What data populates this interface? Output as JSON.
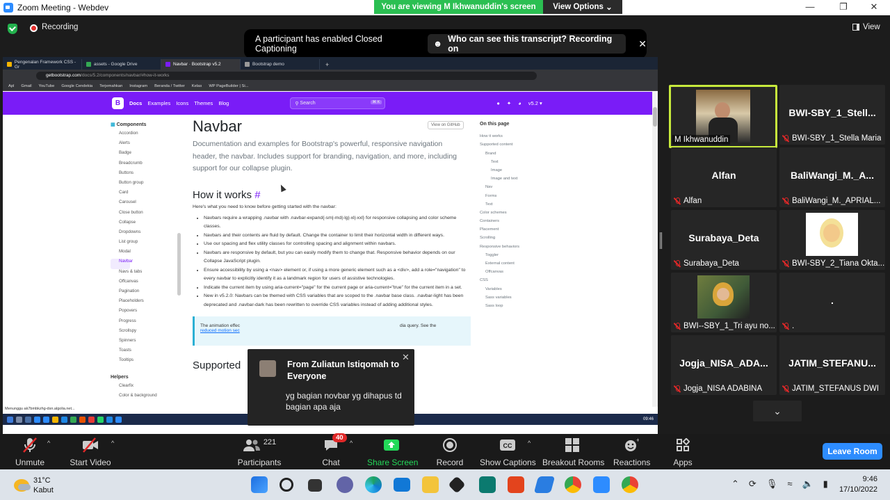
{
  "window": {
    "title": "Zoom Meeting - Webdev",
    "controls": [
      "—",
      "❐",
      "✕"
    ]
  },
  "banner": {
    "viewing": "You are viewing M Ikhwanuddin's screen",
    "view_options": "View Options"
  },
  "topbar": {
    "recording": "Recording",
    "view": "View"
  },
  "caption_bar": {
    "message": "A participant has enabled Closed Captioning",
    "transcript": "Who can see this transcript? Recording on",
    "close": "✕"
  },
  "browser": {
    "tabs": [
      "Pengenalan Framework CSS - Gr",
      "assets - Google Drive",
      "Navbar · Bootstrap v5.2",
      "Bootstrap demo"
    ],
    "new_tab": "+",
    "url_host": "getbootstrap.com",
    "url_path": "/docs/5.2/components/navbar/#how-it-works",
    "bookmarks": [
      "Apl",
      "Gmail",
      "YouTube",
      "Google Cendekia",
      "Terjemahkan",
      "Instagram",
      "Beranda / Twitter",
      "Kelas",
      "WP PageBuilder | Si..."
    ],
    "status": "Menunggu ak7bmbkzhg-dsn.algolia.net...",
    "clock": "09:46"
  },
  "bootstrap": {
    "logo": "B",
    "nav": [
      "Docs",
      "Examples",
      "Icons",
      "Themes",
      "Blog"
    ],
    "search": "Search",
    "search_kbd": "⌘ K",
    "version": "v5.2 ▾",
    "sidenav_title": "Components",
    "sidenav": [
      "Accordion",
      "Alerts",
      "Badge",
      "Breadcrumb",
      "Buttons",
      "Button group",
      "Card",
      "Carousel",
      "Close button",
      "Collapse",
      "Dropdowns",
      "List group",
      "Modal",
      "Navbar",
      "Navs & tabs",
      "Offcanvas",
      "Pagination",
      "Placeholders",
      "Popovers",
      "Progress",
      "Scrollspy",
      "Spinners",
      "Toasts",
      "Tooltips"
    ],
    "sidenav_active": "Navbar",
    "helpers_title": "Helpers",
    "helpers": [
      "Clearfix",
      "Color & background"
    ],
    "title": "Navbar",
    "view_github": "View on GitHub",
    "lead": "Documentation and examples for Bootstrap's powerful, responsive navigation header, the navbar. Includes support for branding, navigation, and more, including support for our collapse plugin.",
    "h2": "How it works",
    "hash": "#",
    "intro": "Here's what you need to know before getting started with the navbar:",
    "bullets": [
      "Navbars require a wrapping .navbar with .navbar-expand{-sm|-md|-lg|-xl|-xxl} for responsive collapsing and color scheme classes.",
      "Navbars and their contents are fluid by default. Change the container to limit their horizontal width in different ways.",
      "Use our spacing and flex utility classes for controlling spacing and alignment within navbars.",
      "Navbars are responsive by default, but you can easily modify them to change that. Responsive behavior depends on our Collapse JavaScript plugin.",
      "Ensure accessibility by using a <nav> element or, if using a more generic element such as a <div>, add a role=\"navigation\" to every navbar to explicitly identify it as a landmark region for users of assistive technologies.",
      "Indicate the current item by using aria-current=\"page\" for the current page or aria-current=\"true\" for the current item in a set.",
      "New in v5.2.0: Navbars can be themed with CSS variables that are scoped to the .navbar base class. .navbar-light has been deprecated and .navbar-dark has been rewritten to override CSS variables instead of adding additional styles."
    ],
    "note_start": "The animation effec",
    "note_end": "dia query. See the",
    "note_link": "reduced motion sec",
    "supported": "Supported",
    "toc_title": "On this page",
    "toc": [
      "How it works",
      "Supported content",
      "Brand",
      "Text",
      "Image",
      "Image and text",
      "Nav",
      "Forms",
      "Text",
      "Color schemes",
      "Containers",
      "Placement",
      "Scrolling",
      "Responsive behaviors",
      "Toggler",
      "External content",
      "Offcanvas",
      "CSS",
      "Variables",
      "Sass variables",
      "Sass loop"
    ]
  },
  "chat_popup": {
    "from": "From Zuliatun Istiqomah to Everyone",
    "message": "yg bagian novbar yg dihapus td bagian apa aja",
    "close": "✕"
  },
  "gallery": [
    {
      "name": "",
      "label": "M Ikhwanuddin",
      "muted": false
    },
    {
      "name": "BWI-SBY_1_Stell...",
      "label": "BWI-SBY_1_Stella Maria",
      "muted": true
    },
    {
      "name": "Alfan",
      "label": "Alfan",
      "muted": true
    },
    {
      "name": "BaliWangi_M._A...",
      "label": "BaliWangi_M._APRIAL...",
      "muted": true
    },
    {
      "name": "Surabaya_Deta",
      "label": "Surabaya_Deta",
      "muted": true
    },
    {
      "name": "",
      "label": "BWI-SBY_2_Tiana Okta...",
      "muted": true
    },
    {
      "name": "",
      "label": "BWI--SBY_1_Tri ayu no...",
      "muted": true
    },
    {
      "name": ".",
      "label": ".",
      "muted": true
    },
    {
      "name": "Jogja_NISA_ADA...",
      "label": "Jogja_NISA ADABINA",
      "muted": true
    },
    {
      "name": "JATIM_STEFANU...",
      "label": "JATIM_STEFANUS DWI",
      "muted": true
    }
  ],
  "controls": {
    "unmute": "Unmute",
    "start_video": "Start Video",
    "participants": "Participants",
    "participants_count": "221",
    "chat": "Chat",
    "chat_badge": "40",
    "share": "Share Screen",
    "record": "Record",
    "captions": "Show Captions",
    "breakout": "Breakout Rooms",
    "reactions": "Reactions",
    "apps": "Apps",
    "leave": "Leave Room",
    "caret": "^"
  },
  "taskbar": {
    "temp": "31°C",
    "weather": "Kabut",
    "time": "9:46",
    "date": "17/10/2022"
  },
  "colors": {
    "zoom_blue": "#2d8cff",
    "share_green": "#23d959",
    "bootstrap_purple": "#7a1cf7",
    "highlight": "#c7ea3c",
    "mute_red": "#e02828"
  }
}
